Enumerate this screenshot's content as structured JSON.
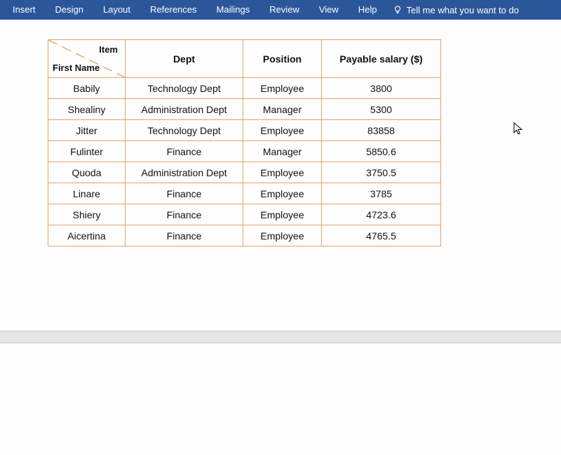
{
  "ribbon": {
    "tabs": [
      "Insert",
      "Design",
      "Layout",
      "References",
      "Mailings",
      "Review",
      "View",
      "Help"
    ],
    "tellme": "Tell me what you want to do"
  },
  "table": {
    "diag": {
      "top": "Item",
      "bottom": "First Name"
    },
    "headers": [
      "Dept",
      "Position",
      "Payable salary ($)"
    ],
    "rows": [
      {
        "name": "Babily",
        "dept": "Technology Dept",
        "position": "Employee",
        "salary": "3800"
      },
      {
        "name": "Shealiny",
        "dept": "Administration Dept",
        "position": "Manager",
        "salary": "5300"
      },
      {
        "name": "Jitter",
        "dept": "Technology Dept",
        "position": "Employee",
        "salary": "83858"
      },
      {
        "name": "Fulinter",
        "dept": "Finance",
        "position": "Manager",
        "salary": "5850.6"
      },
      {
        "name": "Quoda",
        "dept": "Administration Dept",
        "position": "Employee",
        "salary": "3750.5"
      },
      {
        "name": "Linare",
        "dept": "Finance",
        "position": "Employee",
        "salary": "3785"
      },
      {
        "name": "Shiery",
        "dept": "Finance",
        "position": "Employee",
        "salary": "4723.6"
      },
      {
        "name": "Aicertina",
        "dept": "Finance",
        "position": "Employee",
        "salary": "4765.5"
      }
    ]
  }
}
